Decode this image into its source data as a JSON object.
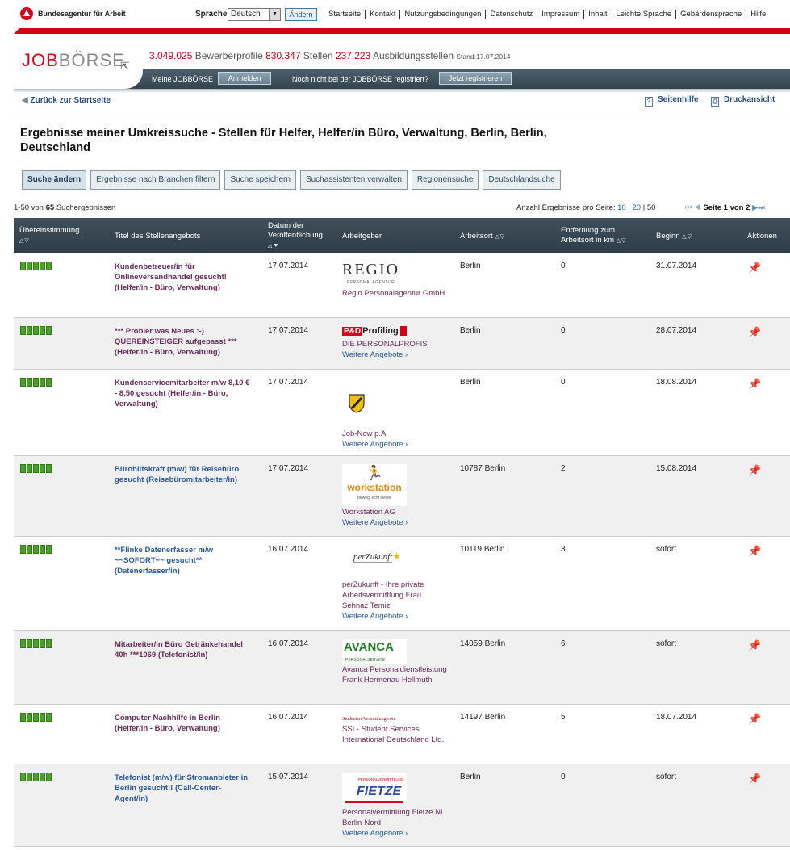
{
  "topbar": {
    "org": "Bundesagentur für Arbeit",
    "language_label": "Sprache",
    "language_value": "Deutsch",
    "language_button": "Ändern",
    "links": [
      "Startseite",
      "Kontakt",
      "Nutzungsbedingungen",
      "Datenschutz",
      "Impressum",
      "Inhalt",
      "Leichte Sprache",
      "Gebärdensprache",
      "Hilfe"
    ]
  },
  "header": {
    "logo_red": "JOB",
    "logo_grey": "BÖRSE",
    "profiles_count": "3.049.025",
    "profiles_label": "Bewerberprofile",
    "jobs_count": "830.347",
    "jobs_label": "Stellen",
    "training_count": "237.223",
    "training_label": "Ausbildungsstellen",
    "stand": "Stand:17.07.2014"
  },
  "nav": {
    "my_jobboerse": "Meine JOBBÖRSE",
    "login_button": "Anmelden",
    "not_registered": "Noch nicht bei der JOBBÖRSE registriert?",
    "register_button": "Jetzt registrieren"
  },
  "subnav": {
    "back": "Zurück zur Startseite",
    "help": "Seitenhilfe",
    "print": "Druckansicht"
  },
  "page_title": "Ergebnisse meiner Umkreissuche - Stellen für Helfer, Helfer/in Büro, Verwaltung, Berlin, Berlin, Deutschland",
  "buttons": [
    "Suche ändern",
    "Ergebnisse nach Branchen filtern",
    "Suche speichern",
    "Suchassistenten verwalten",
    "Regionensuche",
    "Deutschlandsuche"
  ],
  "results": {
    "range": "1-50 von",
    "total": "65",
    "label": "Suchergebnissen",
    "per_page_label": "Anzahl Ergebnisse pro Seite:",
    "per_page_10": "10",
    "per_page_20": "20",
    "per_page_50": "50",
    "page_info": "Seite 1 von 2"
  },
  "columns": {
    "match": "Übereinstimmung",
    "title": "Titel des Stellenangebots",
    "date": "Datum der Veröffentlichung",
    "employer": "Arbeitgeber",
    "place": "Arbeitsort",
    "distance": "Entfernung zum Arbeitsort in km",
    "start": "Beginn",
    "actions": "Aktionen"
  },
  "more_offers": "Weitere Angebote",
  "rows": [
    {
      "title": "Kundenbetreuer/in für Onlineversandhandel gesucht! (Helfer/in - Büro, Verwaltung)",
      "date": "17.07.2014",
      "logo": "REGIO",
      "logo_sub": "PERSONALAGENTUR",
      "employer": "Regio Personalagentur GmbH",
      "place": "Berlin",
      "distance": "0",
      "start": "31.07.2014"
    },
    {
      "title": "*** Probier was Neues :-) QUEREINSTEIGER aufgepasst *** (Helfer/in - Büro, Verwaltung)",
      "date": "17.07.2014",
      "logo": "P&D",
      "logo_sub": "Profiling",
      "employer": "DIE PERSONALPROFIS",
      "place": "Berlin",
      "distance": "0",
      "start": "28.07.2014"
    },
    {
      "title": "Kundenservicemitarbeiter m/w 8,10 € - 8,50 gesucht (Helfer/in - Büro, Verwaltung)",
      "date": "17.07.2014",
      "employer": "Job-Now p.A.",
      "place": "Berlin",
      "distance": "0",
      "start": "18.08.2014"
    },
    {
      "title": "Bürohilfskraft (m/w) für Reisebüro gesucht (Reisebüromitarbeiter/in)",
      "date": "17.07.2014",
      "logo": "workstation",
      "logo_sub": "bewegt echt clever",
      "employer": "Workstation AG",
      "place": "10787 Berlin",
      "distance": "2",
      "start": "15.08.2014"
    },
    {
      "title": "**Flinke Datenerfasser m/w ~~SOFORT~~ gesucht** (Datenerfasser/in)",
      "date": "16.07.2014",
      "logo": "perZukunft",
      "employer": "perZukunft - Ihre private Arbeitsvermittlung Frau Sehnaz Temiz",
      "place": "10119 Berlin",
      "distance": "3",
      "start": "sofort"
    },
    {
      "title": "Mitarbeiter/in Büro Getränkehandel 40h ***1069 (Telefonist/in)",
      "date": "16.07.2014",
      "logo": "AVANCA",
      "logo_sub": "PERSONALSERVICE",
      "employer": "Avanca Personaldienstleistung Frank Hermenau Hellmuth",
      "place": "14059 Berlin",
      "distance": "6",
      "start": "sofort"
    },
    {
      "title": "Computer Nachhilfe in Berlin (Helfer/in - Büro, Verwaltung)",
      "date": "16.07.2014",
      "logo": "Studenten-Vermittlung.com",
      "employer": "SSI - Student Services International Deutschland Ltd.",
      "place": "14197 Berlin",
      "distance": "5",
      "start": "18.07.2014"
    },
    {
      "title": "Telefonist (m/w) für Stromanbieter in Berlin gesucht!! (Call-Center-Agent/in)",
      "date": "15.07.2014",
      "logo": "FIETZE",
      "logo_sub": "PERSONALVERMITTLUNG",
      "employer": "Personalvermittlung Fietze NL Berlin-Nord",
      "place": "Berlin",
      "distance": "0",
      "start": "sofort"
    }
  ]
}
